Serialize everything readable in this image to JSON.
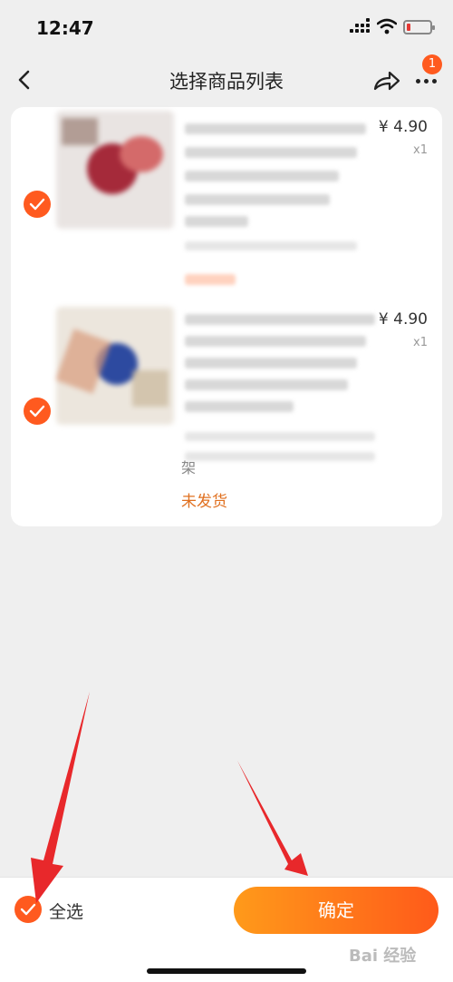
{
  "status_bar": {
    "time": "12:47"
  },
  "nav": {
    "title": "选择商品列表",
    "badge_count": "1"
  },
  "items": [
    {
      "price": "¥ 4.90",
      "qty": "x1",
      "checked": true
    },
    {
      "price": "¥ 4.90",
      "qty": "x1",
      "partial_text": "架",
      "status": "未发货",
      "checked": true
    }
  ],
  "bottom_bar": {
    "select_all_label": "全选",
    "confirm_label": "确定",
    "watermark": "Bai 经验"
  },
  "colors": {
    "accent": "#ff5a1f",
    "status": "#e07020",
    "arrow": "#e8282b"
  }
}
